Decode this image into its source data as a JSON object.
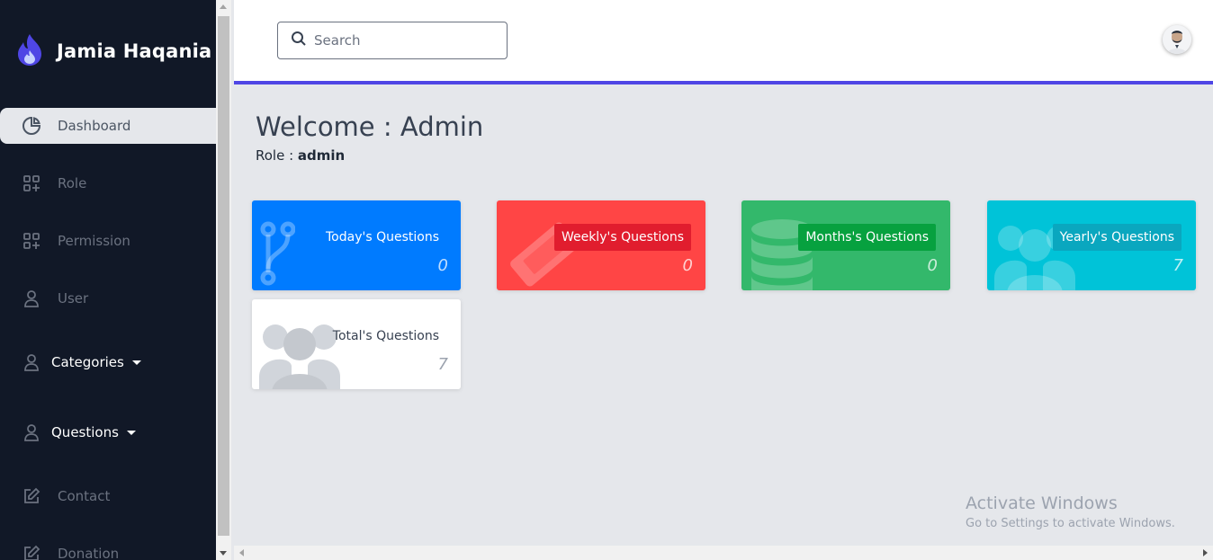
{
  "brand": {
    "name": "Jamia Haqania",
    "icon": "flame-icon"
  },
  "sidebar": {
    "items": [
      {
        "label": "Dashboard",
        "icon": "pie-chart-icon"
      },
      {
        "label": "Role",
        "icon": "grid-plus-icon"
      },
      {
        "label": "Permission",
        "icon": "grid-plus-icon"
      },
      {
        "label": "User",
        "icon": "user-icon"
      },
      {
        "label": "Categories",
        "icon": "user-icon"
      },
      {
        "label": "Questions",
        "icon": "user-icon"
      },
      {
        "label": "Contact",
        "icon": "edit-icon"
      },
      {
        "label": "Donation",
        "icon": "edit-icon"
      }
    ]
  },
  "header": {
    "search_placeholder": "Search",
    "avatar": "user-avatar"
  },
  "main": {
    "welcome": "Welcome : Admin",
    "role_label": "Role : ",
    "role_value": "admin"
  },
  "cards": [
    {
      "label": "Today's Questions",
      "value": "0",
      "color": "#007bff",
      "icon": "branch-icon"
    },
    {
      "label": "Weekly's Questions",
      "value": "0",
      "color": "#ff4545",
      "icon": "ticket-icon"
    },
    {
      "label": "Months's Questions",
      "value": "0",
      "color": "#33b86b",
      "icon": "database-icon"
    },
    {
      "label": "Yearly's Questions",
      "value": "7",
      "color": "#00c3d8",
      "icon": "users-icon"
    },
    {
      "label": "Total's Questions",
      "value": "7",
      "color": "#ffffff",
      "icon": "users-icon"
    }
  ],
  "watermark": {
    "title": "Activate Windows",
    "subtitle": "Go to Settings to activate Windows."
  },
  "accent_color": "#4f46e5",
  "sidebar_color": "#111827"
}
